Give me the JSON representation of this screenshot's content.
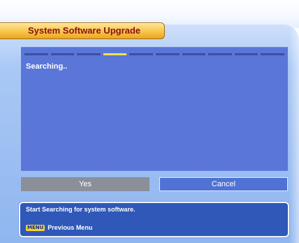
{
  "header": {
    "title": "System Software Upgrade"
  },
  "progress": {
    "segments": 10,
    "active_segment_index": 3,
    "colors": {
      "idle": "#3c4f9e",
      "active": "#f4e04a"
    }
  },
  "content": {
    "status": "Searching.."
  },
  "buttons": {
    "yes_label": "Yes",
    "cancel_label": "Cancel"
  },
  "help": {
    "description": "Start Searching for system software.",
    "menu_key": "MENU",
    "menu_action": "Previous Menu"
  },
  "colors": {
    "title_text": "#8b1010",
    "content_bg": "#5a76d8",
    "help_bg": "#2f58b8"
  }
}
